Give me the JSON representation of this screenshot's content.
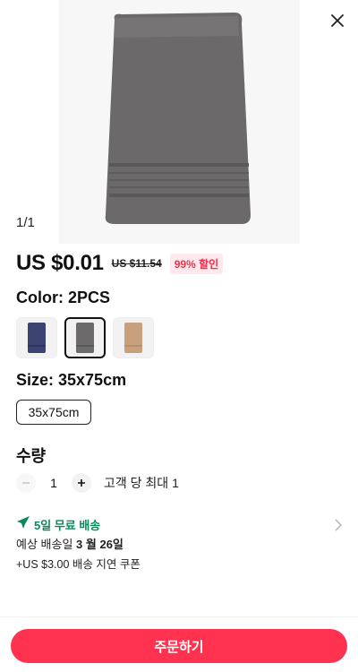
{
  "gallery": {
    "indicator": "1/1"
  },
  "price": {
    "current": "US $0.01",
    "original": "US $11.54",
    "discount": "99% 할인"
  },
  "color": {
    "title": "Color: 2PCS",
    "options": [
      {
        "name": "navy",
        "color": "#3b4470"
      },
      {
        "name": "gray",
        "color": "#6c6a6b"
      },
      {
        "name": "tan",
        "color": "#c9a07e"
      }
    ]
  },
  "size": {
    "title": "Size: 35x75cm",
    "selected": "35x75cm"
  },
  "quantity": {
    "title": "수량",
    "value": "1",
    "limit": "고객 당 최대 1"
  },
  "shipping": {
    "free_label": "5일 무료 배송",
    "eta_prefix": "예상 배송일",
    "eta_date": "3 월 26일",
    "coupon": "+US $3.00 배송 지연 쿠폰",
    "accent": "#0a8a5a"
  },
  "actions": {
    "order_label": "주문하기",
    "accent": "#ff3350"
  }
}
